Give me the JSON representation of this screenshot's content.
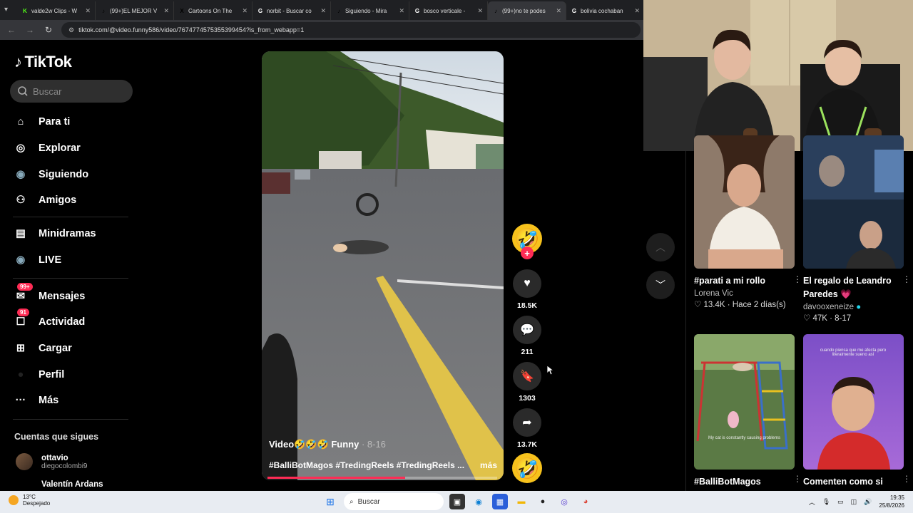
{
  "browser": {
    "tabs": [
      {
        "label": "valde2w Clips - W",
        "favicon": "K",
        "color": "#53fc18",
        "active": false
      },
      {
        "label": "(99+)EL MEJOR V",
        "favicon": "♪",
        "color": "#000000",
        "active": false
      },
      {
        "label": "Cartoons On The",
        "favicon": "X",
        "color": "#000000",
        "active": false
      },
      {
        "label": "norbit - Buscar co",
        "favicon": "G",
        "color": "#ffffff",
        "active": false
      },
      {
        "label": "Siguiendo - Mira",
        "favicon": "♪",
        "color": "#000000",
        "active": false
      },
      {
        "label": "bosco verticale -",
        "favicon": "G",
        "color": "#ffffff",
        "active": false
      },
      {
        "label": "(99+)no te podes",
        "favicon": "♪",
        "color": "#000000",
        "active": true
      },
      {
        "label": "bolivia cochaban",
        "favicon": "G",
        "color": "#ffffff",
        "active": false
      }
    ],
    "url": "tiktok.com/@video.funny586/video/7674774575355399454?is_from_webapp=1"
  },
  "sidebar": {
    "logo": "TikTok",
    "search_placeholder": "Buscar",
    "nav": [
      {
        "label": "Para ti",
        "icon": "home-icon",
        "badge": ""
      },
      {
        "label": "Explorar",
        "icon": "compass-icon",
        "badge": ""
      },
      {
        "label": "Siguiendo",
        "icon": "following-avatar-icon",
        "badge": ""
      },
      {
        "label": "Amigos",
        "icon": "friends-icon",
        "badge": ""
      },
      {
        "label": "Minidramas",
        "icon": "film-icon",
        "badge": ""
      },
      {
        "label": "LIVE",
        "icon": "live-icon",
        "badge": ""
      },
      {
        "label": "Mensajes",
        "icon": "message-icon",
        "badge": "99+"
      },
      {
        "label": "Actividad",
        "icon": "activity-icon",
        "badge": "91"
      },
      {
        "label": "Cargar",
        "icon": "upload-icon",
        "badge": ""
      },
      {
        "label": "Perfil",
        "icon": "profile-icon",
        "badge": ""
      },
      {
        "label": "Más",
        "icon": "more-icon",
        "badge": ""
      }
    ],
    "following_header": "Cuentas que sigues",
    "following": [
      {
        "name": "ottavio",
        "handle": "diegocolombi9"
      },
      {
        "name": "Valentín Ardans",
        "handle": ""
      }
    ]
  },
  "video": {
    "caption": "Video🤣🤣🤣 Funny",
    "date": "· 8-16",
    "tags": "#BalliBotMagos #TredingReels #TredingReels ...",
    "more": "más",
    "progress": 0.6
  },
  "actions": {
    "likes": "18.5K",
    "comments": "211",
    "saves": "1303",
    "shares": "13.7K"
  },
  "recommendations": [
    {
      "title": "#parati a mi rollo",
      "user": "Lorena Vic",
      "stat": "♡ 13.4K · Hace 2 días(s)"
    },
    {
      "title": "El regalo de Leandro Paredes 💗",
      "user": "davooxeneize",
      "stat": "♡ 47K · 8-17"
    },
    {
      "title": "#BalliBotMagos",
      "user": "",
      "stat": "",
      "overlay": "My cat is constantly causing problems"
    },
    {
      "title": "Comenten como si",
      "user": "",
      "stat": "",
      "overlay": "cuando piensa que me afecta pero literalmente sueno así"
    }
  ],
  "taskbar": {
    "temp": "13°C",
    "weather": "Despejado",
    "search": "Buscar",
    "time": "19:35",
    "date": "25/8/2026"
  },
  "colors": {
    "accent": "#fe2c55",
    "background": "#000000",
    "verified": "#20d5ec"
  }
}
